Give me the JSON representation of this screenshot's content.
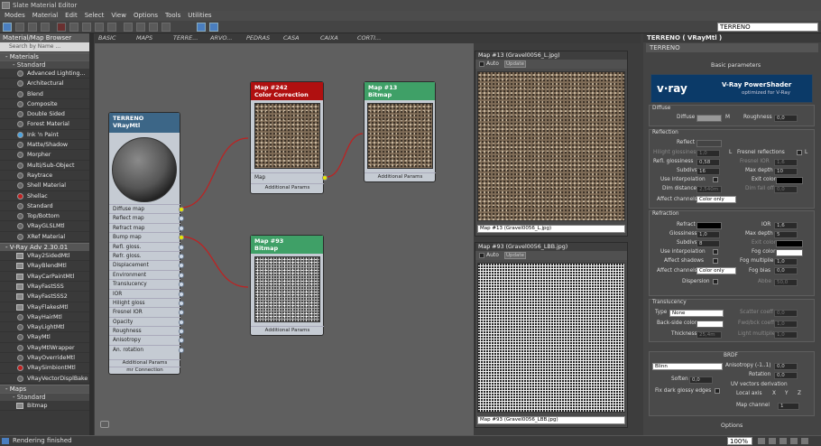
{
  "window": {
    "title": "Slate Material Editor"
  },
  "menu": [
    "Modes",
    "Material",
    "Edit",
    "Select",
    "View",
    "Options",
    "Tools",
    "Utilities"
  ],
  "toolbar": {
    "material_combo": "TERRENO"
  },
  "browser": {
    "title": "Material/Map Browser",
    "search_placeholder": "Search by Name ...",
    "materials_section": "- Materials",
    "standard_sub": "- Standard",
    "materials": [
      "Advanced Lighting...",
      "Architectural",
      "Blend",
      "Composite",
      "Double Sided",
      "Forest Material",
      "Ink 'n Paint",
      "Matte/Shadow",
      "Morpher",
      "Multi/Sub-Object",
      "Raytrace",
      "Shell Material",
      "Shellac",
      "Standard",
      "Top/Bottom",
      "VRayGLSLMtl",
      "XRef Material"
    ],
    "vray_section": "- V-Ray Adv 2.30.01",
    "vray_items": [
      "VRay2SidedMtl",
      "VRayBlendMtl",
      "VRayCarPaintMtl",
      "VRayFastSSS",
      "VRayFastSSS2",
      "VRayFlakesMtl",
      "VRayHairMtl",
      "VRayLightMtl",
      "VRayMtl",
      "VRayMtlWrapper",
      "VRayOverrideMtl",
      "VRaySimbiontMtl",
      "VRayVectorDisplBake"
    ],
    "maps_section": "- Maps",
    "maps_standard": "- Standard",
    "maps_first": "Bitmap"
  },
  "view_tabs": [
    "BASIC",
    "MAPS",
    "TERRE...",
    "ARVO...",
    "PEDRAS",
    "CASA",
    "CAIXA",
    "CORTI..."
  ],
  "nodes": {
    "terreno": {
      "title": "TERRENO",
      "subtitle": "VRayMtl",
      "slots": [
        "Diffuse map",
        "Reflect map",
        "Refract map",
        "Bump map",
        "Refl. gloss.",
        "Refr. gloss.",
        "Displacement",
        "Environment",
        "Translucency",
        "IOR",
        "Hilight gloss",
        "Fresnel IOR",
        "Opacity",
        "Roughness",
        "Anisotropy",
        "An. rotation"
      ],
      "footer1": "Additional Params",
      "footer2": "mr Connection"
    },
    "cc": {
      "title": "Map #242",
      "subtitle": "Color Correction",
      "slot": "Map",
      "footer": "Additional Params"
    },
    "map13": {
      "title": "Map #13",
      "subtitle": "Bitmap",
      "footer": "Additional Params"
    },
    "map93": {
      "title": "Map #93",
      "subtitle": "Bitmap",
      "footer": "Additional Params"
    }
  },
  "viewer1": {
    "title": "Map #13 (Gravel0056_L.jpg)",
    "auto": "Auto",
    "update": "Update",
    "combo": "Map #13 (Gravel0056_L.jpg)"
  },
  "viewer2": {
    "title": "Map #93 (Gravel0056_LBB.jpg)",
    "auto": "Auto",
    "update": "Update",
    "combo": "Map #93 (Gravel0056_LBB.jpg)"
  },
  "props": {
    "header": "TERRENO ( VRayMtl )",
    "name": "TERRENO",
    "basic": "Basic parameters",
    "banner": {
      "logo": "v·ray",
      "title": "V-Ray PowerShader",
      "sub": "optimized for V-Ray"
    },
    "diffuse": {
      "group": "Diffuse",
      "diffuse": "Diffuse",
      "m": "M",
      "roughness": "Roughness",
      "rough_val": "0,0"
    },
    "reflection": {
      "group": "Reflection",
      "reflect": "Reflect",
      "hilight": "Hilight glossiness",
      "hilight_val": "1,0",
      "l": "L",
      "fresnel": "Fresnel reflections",
      "l2": "L",
      "refl_gloss": "Refl. glossiness",
      "refl_gloss_val": "0,58",
      "fresnel_ior": "Fresnel IOR",
      "fresnel_ior_val": "1,6",
      "subdivs": "Subdivs",
      "subdivs_val": "16",
      "max_depth": "Max depth",
      "max_depth_val": "10",
      "interp": "Use interpolation",
      "exit": "Exit color",
      "dim_dist": "Dim distance",
      "dim_dist_val": "2,540m",
      "dim_fall": "Dim fall off",
      "dim_fall_val": "0,0",
      "affect": "Affect channels",
      "affect_val": "Color only"
    },
    "refraction": {
      "group": "Refraction",
      "refract": "Refract",
      "ior": "IOR",
      "ior_val": "1,6",
      "gloss": "Glossiness",
      "gloss_val": "1,0",
      "max_depth": "Max depth",
      "max_depth_val": "5",
      "subdivs": "Subdivs",
      "subdivs_val": "8",
      "exit": "Exit color",
      "interp": "Use interpolation",
      "fog": "Fog color",
      "affect_sh": "Affect shadows",
      "fog_mult": "Fog multiplier",
      "fog_mult_val": "1,0",
      "affect": "Affect channels",
      "affect_val": "Color only",
      "fog_bias": "Fog bias",
      "fog_bias_val": "0,0",
      "dispersion": "Dispersion",
      "abbe": "Abbe",
      "abbe_val": "50,0"
    },
    "translucency": {
      "group": "Translucency",
      "type": "Type",
      "type_val": "None",
      "scatter": "Scatter coeff",
      "scatter_val": "0,0",
      "back": "Back-side color",
      "fwd": "Fwd/bck coeff",
      "fwd_val": "1,0",
      "thick": "Thickness",
      "thick_val": "25,4m",
      "light": "Light multiplier",
      "light_val": "1,0"
    },
    "brdf": {
      "group": "BRDF",
      "type": "Blinn",
      "aniso": "Anisotropy (-1..1)",
      "aniso_val": "0,0",
      "rotation": "Rotation",
      "rotation_val": "0,0",
      "soften": "Soften",
      "soften_val": "0,0",
      "uv": "UV vectors derivation",
      "fix": "Fix dark glossy edges",
      "local": "Local axis",
      "x": "X",
      "y": "Y",
      "z": "Z",
      "mapch": "Map channel",
      "mapch_val": "1"
    },
    "options": "Options"
  },
  "status": {
    "text": "Rendering finished",
    "zoom": "100%"
  }
}
